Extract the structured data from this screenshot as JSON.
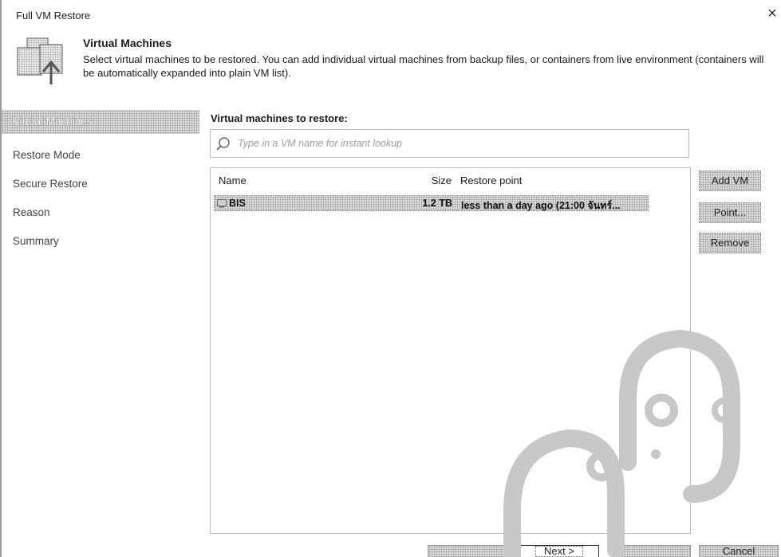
{
  "window": {
    "title": "Full VM Restore",
    "close_glyph": "×"
  },
  "header": {
    "icon": "vm-restore-icon",
    "title": "Virtual Machines",
    "description": "Select virtual machines to be restored. You can add individual virtual machines from backup files, or containers from live environment (containers will be automatically expanded into plain VM list)."
  },
  "nav": {
    "items": [
      {
        "label": "Virtual Machines",
        "active": true
      },
      {
        "label": "Restore Mode",
        "active": false
      },
      {
        "label": "Secure Restore",
        "active": false
      },
      {
        "label": "Reason",
        "active": false
      },
      {
        "label": "Summary",
        "active": false
      }
    ]
  },
  "main": {
    "section_label": "Virtual machines to restore:",
    "search": {
      "placeholder": "Type in a VM name for instant lookup",
      "value": ""
    },
    "table": {
      "columns": [
        "Name",
        "Size",
        "Restore point"
      ],
      "rows": [
        {
          "name": "BIS",
          "size": "1.2 TB",
          "restore_point": "less than a day ago (21:00 จันทร์..."
        }
      ]
    },
    "side_buttons": {
      "add_vm": "Add VM",
      "point": "Point...",
      "remove": "Remove"
    }
  },
  "footer": {
    "previous": "",
    "next": "Next >",
    "finish": "",
    "cancel": "Cancel"
  },
  "colors": {
    "highlight_dither": "#dcdcdc",
    "border": "#bcbcbc",
    "watermark": "#c8c8c8"
  }
}
